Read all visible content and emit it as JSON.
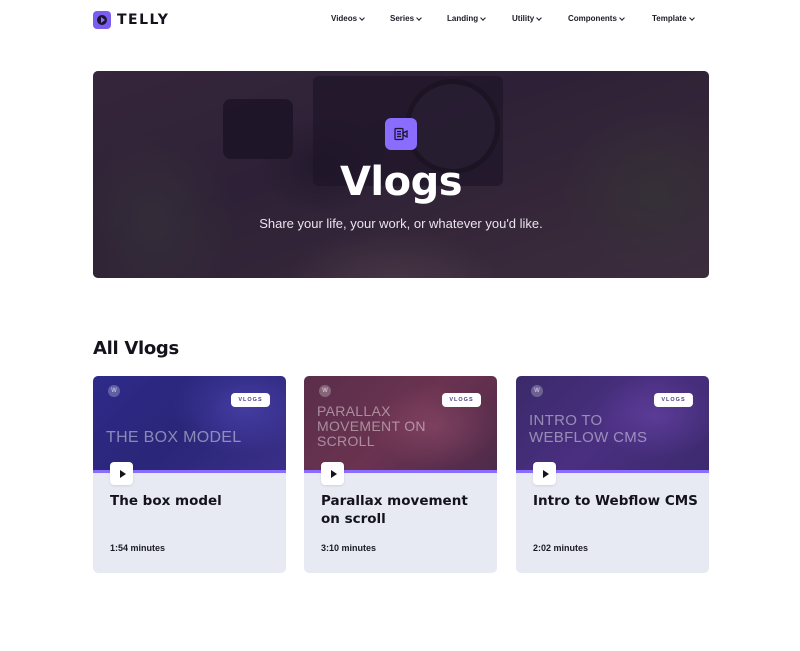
{
  "brand": {
    "name": "TELLY"
  },
  "nav": {
    "items": [
      {
        "label": "Videos"
      },
      {
        "label": "Series"
      },
      {
        "label": "Landing"
      },
      {
        "label": "Utility"
      },
      {
        "label": "Components"
      },
      {
        "label": "Template"
      }
    ]
  },
  "hero": {
    "icon": "video-file-icon",
    "title": "Vlogs",
    "subtitle": "Share your life, your work, or whatever you'd like."
  },
  "section": {
    "title": "All Vlogs"
  },
  "cards": [
    {
      "tag": "VLOGS",
      "thumb_text": "THE BOX MODEL",
      "title": "The box model",
      "duration": "1:54 minutes"
    },
    {
      "tag": "VLOGS",
      "thumb_text": "PARALLAX MOVEMENT ON SCROLL",
      "title": "Parallax movement on scroll",
      "duration": "3:10 minutes"
    },
    {
      "tag": "VLOGS",
      "thumb_text": "INTRO TO WEBFLOW CMS",
      "title": "Intro to Webflow CMS",
      "duration": "2:02 minutes"
    }
  ],
  "colors": {
    "accent": "#8a6cff",
    "card_bg": "#e8eaf3",
    "text": "#14121c"
  }
}
